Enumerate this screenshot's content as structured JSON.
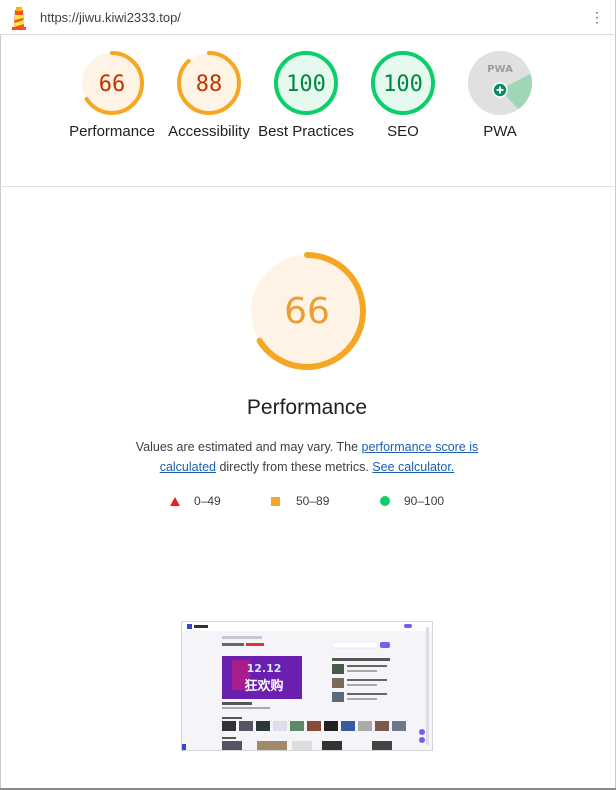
{
  "browser": {
    "url": "https://jiwu.kiwi2333.top/",
    "menu_icon": "more-vert-icon",
    "logo_icon": "lighthouse-icon"
  },
  "categories": [
    {
      "key": "performance",
      "score": "66",
      "label": "Performance",
      "fraction": 0.66,
      "color": "#f5a623",
      "text_color": "#c33300",
      "bg": "#fff3e5"
    },
    {
      "key": "accessibility",
      "score": "88",
      "label": "Accessibility",
      "fraction": 0.88,
      "color": "#f5a623",
      "text_color": "#c33300",
      "bg": "#fff3e5"
    },
    {
      "key": "best-practices",
      "score": "100",
      "label": "Best Practices",
      "fraction": 1.0,
      "color": "#0cce6b",
      "text_color": "#018642",
      "bg": "#e6f9ef"
    },
    {
      "key": "seo",
      "score": "100",
      "label": "SEO",
      "fraction": 1.0,
      "color": "#0cce6b",
      "text_color": "#018642",
      "bg": "#e6f9ef"
    },
    {
      "key": "pwa",
      "score": "PWA",
      "label": "PWA",
      "fraction": null,
      "color": "#9e9e9e",
      "text_color": "#9e9e9e",
      "bg": "#e0e0e0"
    }
  ],
  "main": {
    "score": "66",
    "fraction": 0.66,
    "title": "Performance",
    "desc_prefix": "Values are estimated and may vary. The ",
    "link1": "performance score is calculated",
    "desc_middle": " directly from these metrics.",
    "link2": "See calculator."
  },
  "legend": [
    {
      "shape": "triangle",
      "range": "0–49",
      "color": "#eb1f1f"
    },
    {
      "shape": "square",
      "range": "50–89",
      "color": "#f5a623"
    },
    {
      "shape": "circle",
      "range": "90–100",
      "color": "#0cce6b"
    }
  ],
  "screenshot": {
    "banner_text": "12.12 狂欢购",
    "description": "page screenshot thumbnail"
  }
}
